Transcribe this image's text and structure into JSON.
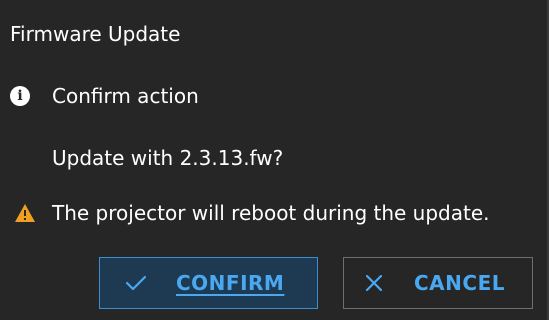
{
  "dialog": {
    "title": "Firmware Update",
    "confirm_heading": "Confirm action",
    "question": "Update with 2.3.13.fw?",
    "warning": "The projector will reboot during the update."
  },
  "buttons": {
    "confirm_label": "CONFIRM",
    "cancel_label": "CANCEL"
  },
  "icons": {
    "info": "info-icon",
    "warning": "warning-icon",
    "confirm": "check-icon",
    "cancel": "close-icon"
  },
  "colors": {
    "background": "#262626",
    "accent": "#4aa8f0",
    "warning": "#f0a020",
    "confirm_button_bg": "#1e3a52"
  }
}
